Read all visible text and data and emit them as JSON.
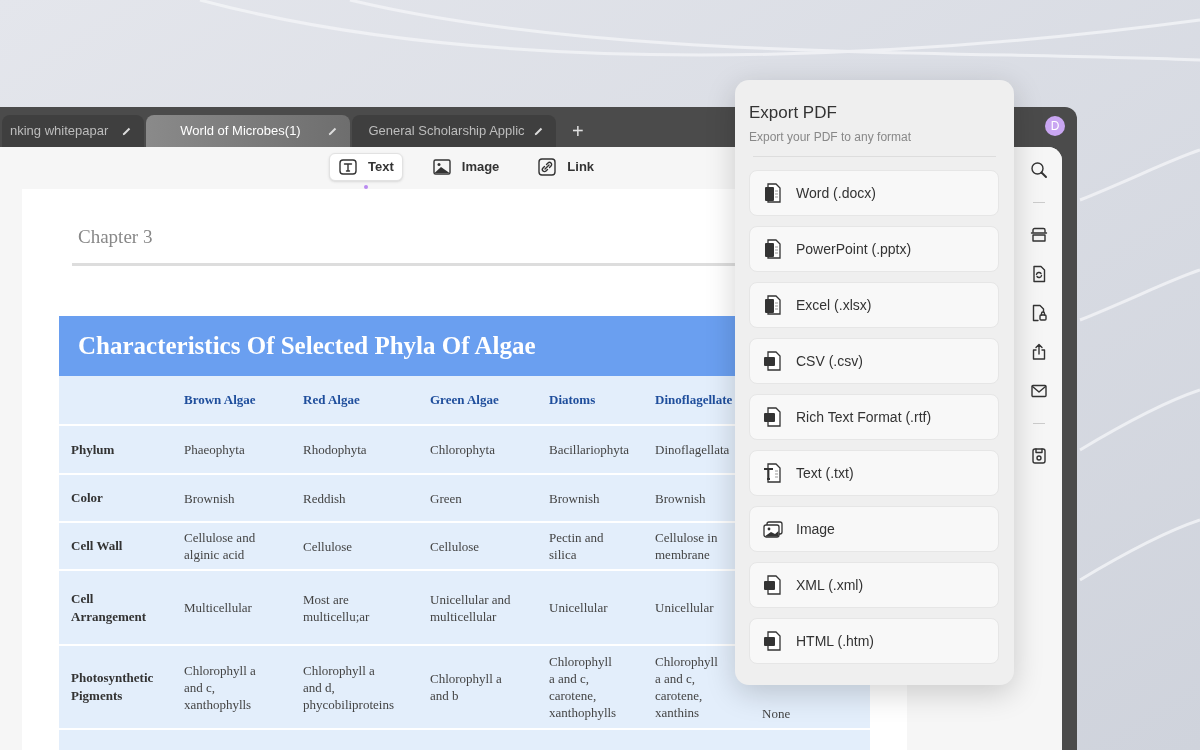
{
  "tabs": [
    {
      "label": "nking whitepapar",
      "selected": false
    },
    {
      "label": "World of Microbes(1)",
      "selected": true
    },
    {
      "label": "General Scholarship Applic",
      "selected": false
    }
  ],
  "new_tab": "+",
  "avatar": "D",
  "edit_tools": [
    {
      "kind": "text",
      "label": "Text",
      "selected": true
    },
    {
      "kind": "image",
      "label": "Image",
      "selected": false
    },
    {
      "kind": "link",
      "label": "Link",
      "selected": false
    }
  ],
  "document": {
    "chapter": "Chapter 3",
    "table": {
      "title": "Characteristics Of Selected Phyla Of Algae",
      "columns": [
        "Brown Algae",
        "Red Algae",
        "Green Algae",
        "Diatoms",
        "Dinoflagellate"
      ],
      "rows": [
        {
          "label": "Phylum",
          "cells": [
            "Phaeophyta",
            "Rhodophyta",
            "Chlorophyta",
            "Bacillariophyta",
            "Dinoflagellata"
          ]
        },
        {
          "label": "Color",
          "cells": [
            "Brownish",
            "Reddish",
            "Green",
            "Brownish",
            "Brownish"
          ]
        },
        {
          "label": "Cell Wall",
          "cells": [
            "Cellulose and alginic acid",
            "Cellulose",
            "Cellulose",
            "Pectin and silica",
            "Cellulose in membrane"
          ]
        },
        {
          "label": "Cell Arrangement",
          "cells": [
            "Multicellular",
            "Most are multicellu;ar",
            "Unicellular and multicellular",
            "Unicellular",
            "Unicellular"
          ]
        },
        {
          "label": "Photosynthetic Pigments",
          "cells": [
            "Chlorophyll a and c, xanthophylls",
            "Chlorophyll a and d, phycobiliproteins",
            "Chlorophyll a and b",
            "Chlorophyll a and c, carotene, xanthophylls",
            "Chlorophyll a and c, carotene, xanthins",
            "None"
          ]
        }
      ]
    }
  },
  "sidebar_tools": [
    {
      "kind": "search"
    },
    {
      "kind": "divider"
    },
    {
      "kind": "ocr"
    },
    {
      "kind": "convert"
    },
    {
      "kind": "protect"
    },
    {
      "kind": "share"
    },
    {
      "kind": "mail"
    },
    {
      "kind": "divider"
    },
    {
      "kind": "save"
    }
  ],
  "export_panel": {
    "title": "Export PDF",
    "subtitle": "Export your PDF to any format",
    "options": [
      {
        "kind": "word",
        "label": "Word (.docx)"
      },
      {
        "kind": "powerpoint",
        "label": "PowerPoint (.pptx)"
      },
      {
        "kind": "excel",
        "label": "Excel (.xlsx)"
      },
      {
        "kind": "csv",
        "label": "CSV (.csv)"
      },
      {
        "kind": "rtf",
        "label": "Rich Text Format (.rtf)"
      },
      {
        "kind": "txt",
        "label": "Text (.txt)"
      },
      {
        "kind": "image",
        "label": "Image"
      },
      {
        "kind": "xml",
        "label": "XML (.xml)"
      },
      {
        "kind": "html",
        "label": "HTML (.htm)"
      }
    ]
  }
}
